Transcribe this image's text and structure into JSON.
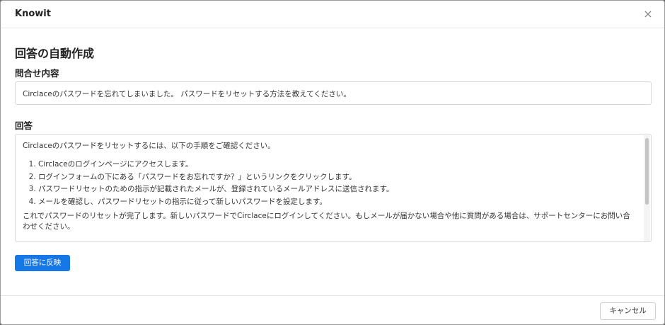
{
  "window": {
    "title": "Knowit",
    "close_symbol": "×"
  },
  "body": {
    "heading": "回答の自動作成",
    "inquiry": {
      "label": "問合せ内容",
      "value": "Circlaceのパスワードを忘れてしまいました。 パスワードをリセットする方法を教えてください。"
    },
    "answer": {
      "label": "回答",
      "intro": "Circlaceのパスワードをリセットするには、以下の手順をご確認ください。",
      "steps": [
        "Circlaceのログインページにアクセスします。",
        "ログインフォームの下にある「パスワードをお忘れですか？」というリンクをクリックします。",
        "パスワードリセットのための指示が記載されたメールが、登録されているメールアドレスに送信されます。",
        "メールを確認し、パスワードリセットの指示に従って新しいパスワードを設定します。"
      ],
      "closing": "これでパスワードのリセットが完了します。新しいパスワードでCirclaceにログインしてください。もしメールが届かない場合や他に質問がある場合は、サポートセンターにお問い合わせください。"
    },
    "apply_button": "回答に反映"
  },
  "footer": {
    "cancel_button": "キャンセル"
  },
  "colors": {
    "primary": "#1677e6",
    "border": "#d9d9d9"
  },
  "icons": {
    "close": "close-icon"
  }
}
